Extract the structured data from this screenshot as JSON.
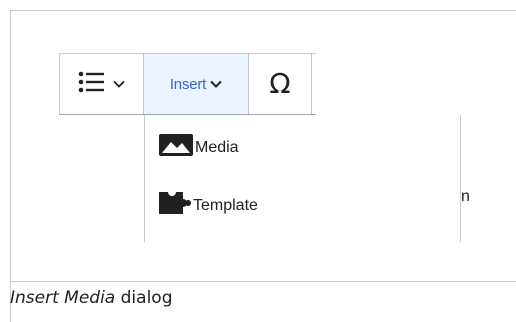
{
  "toolbar": {
    "list_icon": "bullet-list-icon",
    "list_chevron_icon": "chevron-down-icon",
    "insert_label": "Insert",
    "insert_chevron_icon": "chevron-down-icon",
    "special_char_glyph": "Ω"
  },
  "insert_menu": {
    "items": [
      {
        "icon": "media-icon",
        "label": "Media"
      },
      {
        "icon": "puzzle-piece-icon",
        "label": "Template"
      }
    ]
  },
  "partial_glyph": "n",
  "caption": {
    "emphasis": "Insert Media",
    "rest": " dialog"
  },
  "colors": {
    "accent": "#3366cc",
    "active_bg": "#eaf3ff",
    "border": "#c8ccd1",
    "text": "#202122"
  }
}
